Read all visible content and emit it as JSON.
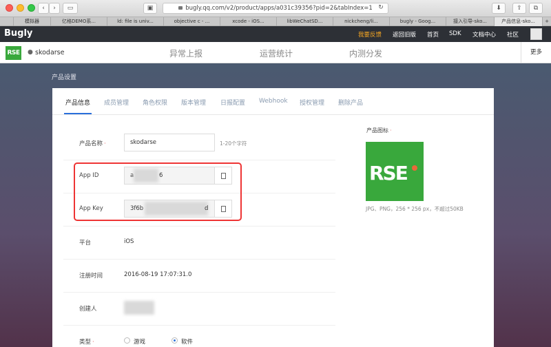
{
  "browser": {
    "url": "bugly.qq.com/v2/product/apps/a031c39356?pid=2&tabIndex=1",
    "tabs": [
      "模拟器",
      "亿格DEMO系...",
      "ld: file is univ...",
      "objective c - ...",
      "xcode - iOS...",
      "libWeChatSD...",
      "nickcheng/li...",
      "bugly - Goog...",
      "接入引导-sko...",
      "产品信息-sko..."
    ]
  },
  "bugly_nav": {
    "logo": "Bugly",
    "feedback": "我要反馈",
    "old_version": "返回旧版",
    "home": "首页",
    "sdk": "SDK",
    "docs": "文档中心",
    "community": "社区"
  },
  "app_header": {
    "logo_text": "RSE",
    "app_name": "skodarse",
    "tabs": [
      "异常上报",
      "运营统计",
      "内测分发"
    ],
    "more": "更多"
  },
  "section_title": "产品设置",
  "settings_tabs": [
    "产品信息",
    "成员管理",
    "角色权限",
    "版本管理",
    "日报配置",
    "Webhook",
    "授权管理",
    "删除产品"
  ],
  "form": {
    "product_name_label": "产品名称",
    "product_name_value": "skodarse",
    "product_name_hint": "1-20个字符",
    "app_id_label": "App ID",
    "app_id_prefix": "a",
    "app_id_suffix": "6",
    "app_key_label": "App Key",
    "app_key_prefix": "3f6b",
    "app_key_suffix": "d",
    "platform_label": "平台",
    "platform_value": "iOS",
    "reg_time_label": "注册时间",
    "reg_time_value": "2016-08-19 17:07:31.0",
    "creator_label": "创建人",
    "type_label": "类型",
    "type_options": [
      "游戏",
      "软件"
    ],
    "type_selected": "软件"
  },
  "product_icon": {
    "label": "产品图标",
    "logo_text": "RSE",
    "hint": "JPG、PNG，256 * 256 px，不超过50KB"
  },
  "colors": {
    "accent": "#2a6fdb",
    "brand_green": "#39a83c",
    "highlight_orange": "#f5a623",
    "annotation_red": "#e33333"
  }
}
